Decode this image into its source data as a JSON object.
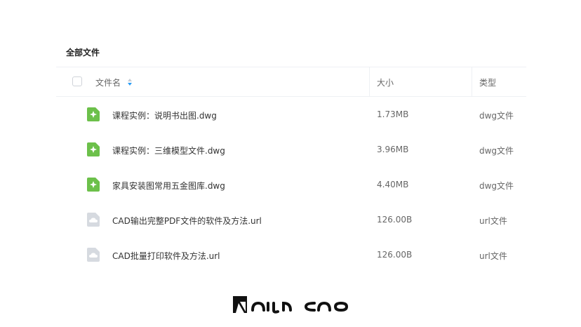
{
  "title": "全部文件",
  "columns": {
    "name": "文件名",
    "size": "大小",
    "type": "类型"
  },
  "files": [
    {
      "name": "课程实例：说明书出图.dwg",
      "size": "1.73MB",
      "type": "dwg文件",
      "icon": "dwg-file-icon"
    },
    {
      "name": "课程实例：三维模型文件.dwg",
      "size": "3.96MB",
      "type": "dwg文件",
      "icon": "dwg-file-icon"
    },
    {
      "name": "家具安装图常用五金图库.dwg",
      "size": "4.40MB",
      "type": "dwg文件",
      "icon": "dwg-file-icon"
    },
    {
      "name": "CAD输出完整PDF文件的软件及方法.url",
      "size": "126.00B",
      "type": "url文件",
      "icon": "url-file-icon"
    },
    {
      "name": "CAD批量打印软件及方法.url",
      "size": "126.00B",
      "type": "url文件",
      "icon": "url-file-icon"
    }
  ],
  "colors": {
    "dwg_icon": "#6cc04a",
    "url_icon": "#d6dae0",
    "sort_accent": "#2a9df4"
  },
  "watermark": "AiJun CAD"
}
